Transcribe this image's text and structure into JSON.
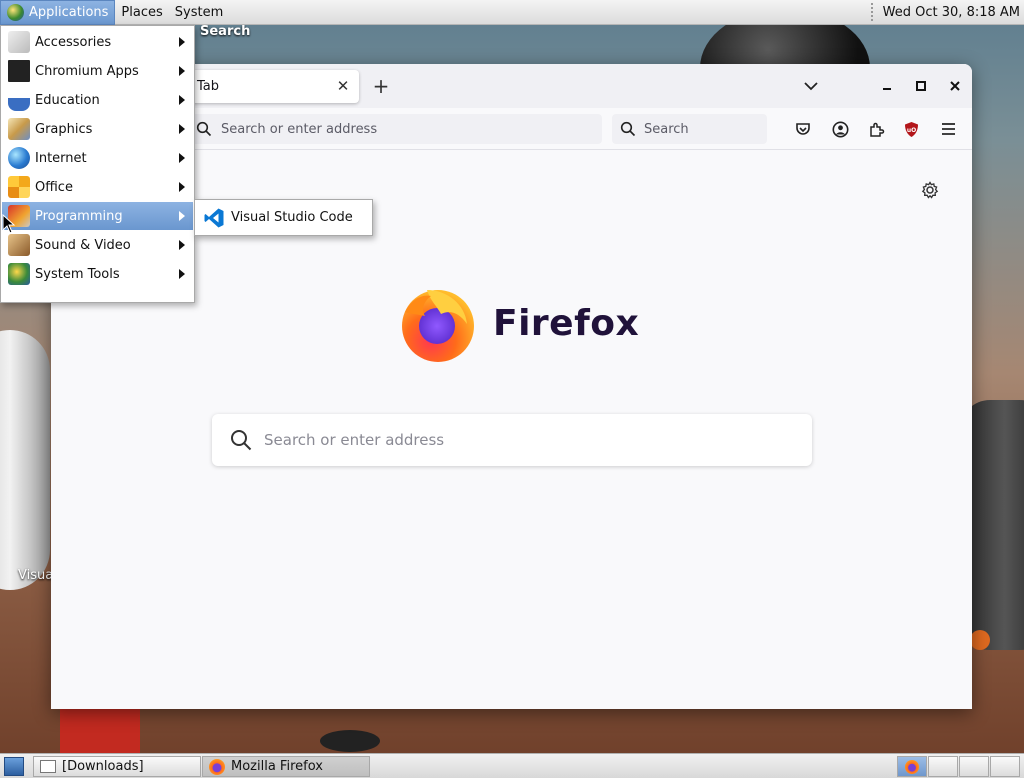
{
  "top_panel": {
    "menus": [
      "Applications",
      "Places",
      "System"
    ],
    "clock": "Wed Oct 30,  8:18 AM"
  },
  "desktop": {
    "icon_label_partial": "Visua",
    "top_label": "Search"
  },
  "firefox": {
    "tab_title": "Tab",
    "url_placeholder": "Search or enter address",
    "search_placeholder": "Search",
    "brand_word": "Firefox",
    "newtab_search_placeholder": "Search or enter address"
  },
  "app_menu": {
    "items": [
      {
        "label": "Accessories",
        "icon": "accessories-icon"
      },
      {
        "label": "Chromium Apps",
        "icon": "chromium-apps-icon"
      },
      {
        "label": "Education",
        "icon": "education-icon"
      },
      {
        "label": "Graphics",
        "icon": "graphics-icon"
      },
      {
        "label": "Internet",
        "icon": "internet-icon"
      },
      {
        "label": "Office",
        "icon": "office-icon"
      },
      {
        "label": "Programming",
        "icon": "programming-icon",
        "highlighted": true
      },
      {
        "label": "Sound & Video",
        "icon": "sound-video-icon"
      },
      {
        "label": "System Tools",
        "icon": "system-tools-icon"
      }
    ],
    "submenu": {
      "label": "Visual Studio Code",
      "icon": "vscode-icon"
    }
  },
  "taskbar": {
    "tasks": [
      {
        "label": "[Downloads]"
      },
      {
        "label": "Mozilla Firefox"
      }
    ]
  },
  "colors": {
    "menu_highlight": "#7aa4da",
    "firefox_text": "#20123a",
    "vscode_blue": "#0a78d4"
  }
}
